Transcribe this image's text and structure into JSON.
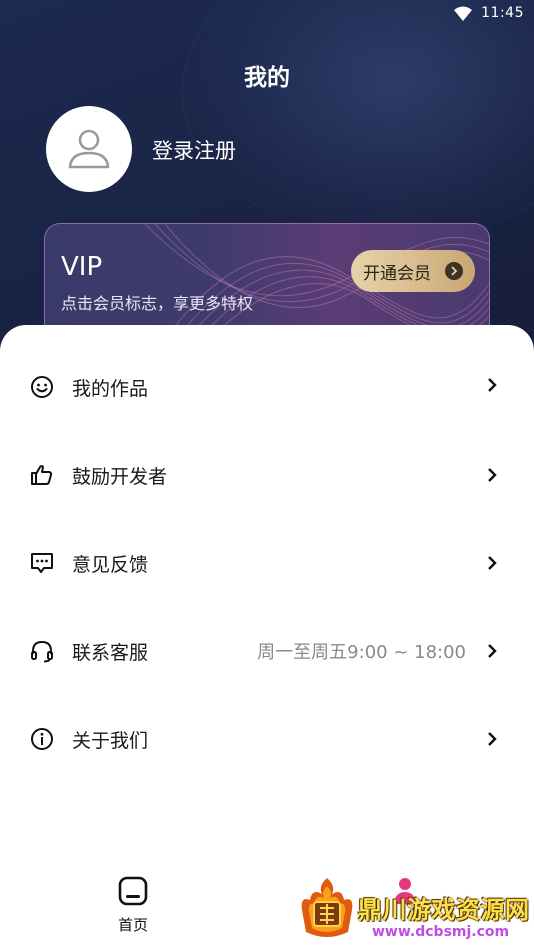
{
  "status_bar": {
    "time": "11:45"
  },
  "header": {
    "title": "我的",
    "login_label": "登录注册"
  },
  "vip_card": {
    "title": "VIP",
    "subtitle": "点击会员标志，享更多特权",
    "button_label": "开通会员"
  },
  "menu": {
    "items": [
      {
        "label": "我的作品",
        "icon": "smiley-icon",
        "extra": ""
      },
      {
        "label": "鼓励开发者",
        "icon": "thumbs-up-icon",
        "extra": ""
      },
      {
        "label": "意见反馈",
        "icon": "chat-bubble-icon",
        "extra": ""
      },
      {
        "label": "联系客服",
        "icon": "headset-icon",
        "extra": "周一至周五9:00 ~ 18:00"
      },
      {
        "label": "关于我们",
        "icon": "info-icon",
        "extra": ""
      }
    ]
  },
  "bottom_nav": {
    "home_label": "首页"
  },
  "watermark": {
    "text": "鼎川游戏资源网",
    "url": "www.dcbsmj.com"
  },
  "colors": {
    "header_bg": "#1b2446",
    "vip_button": "#d9be90",
    "nav_mine_accent": "#e8367e"
  }
}
